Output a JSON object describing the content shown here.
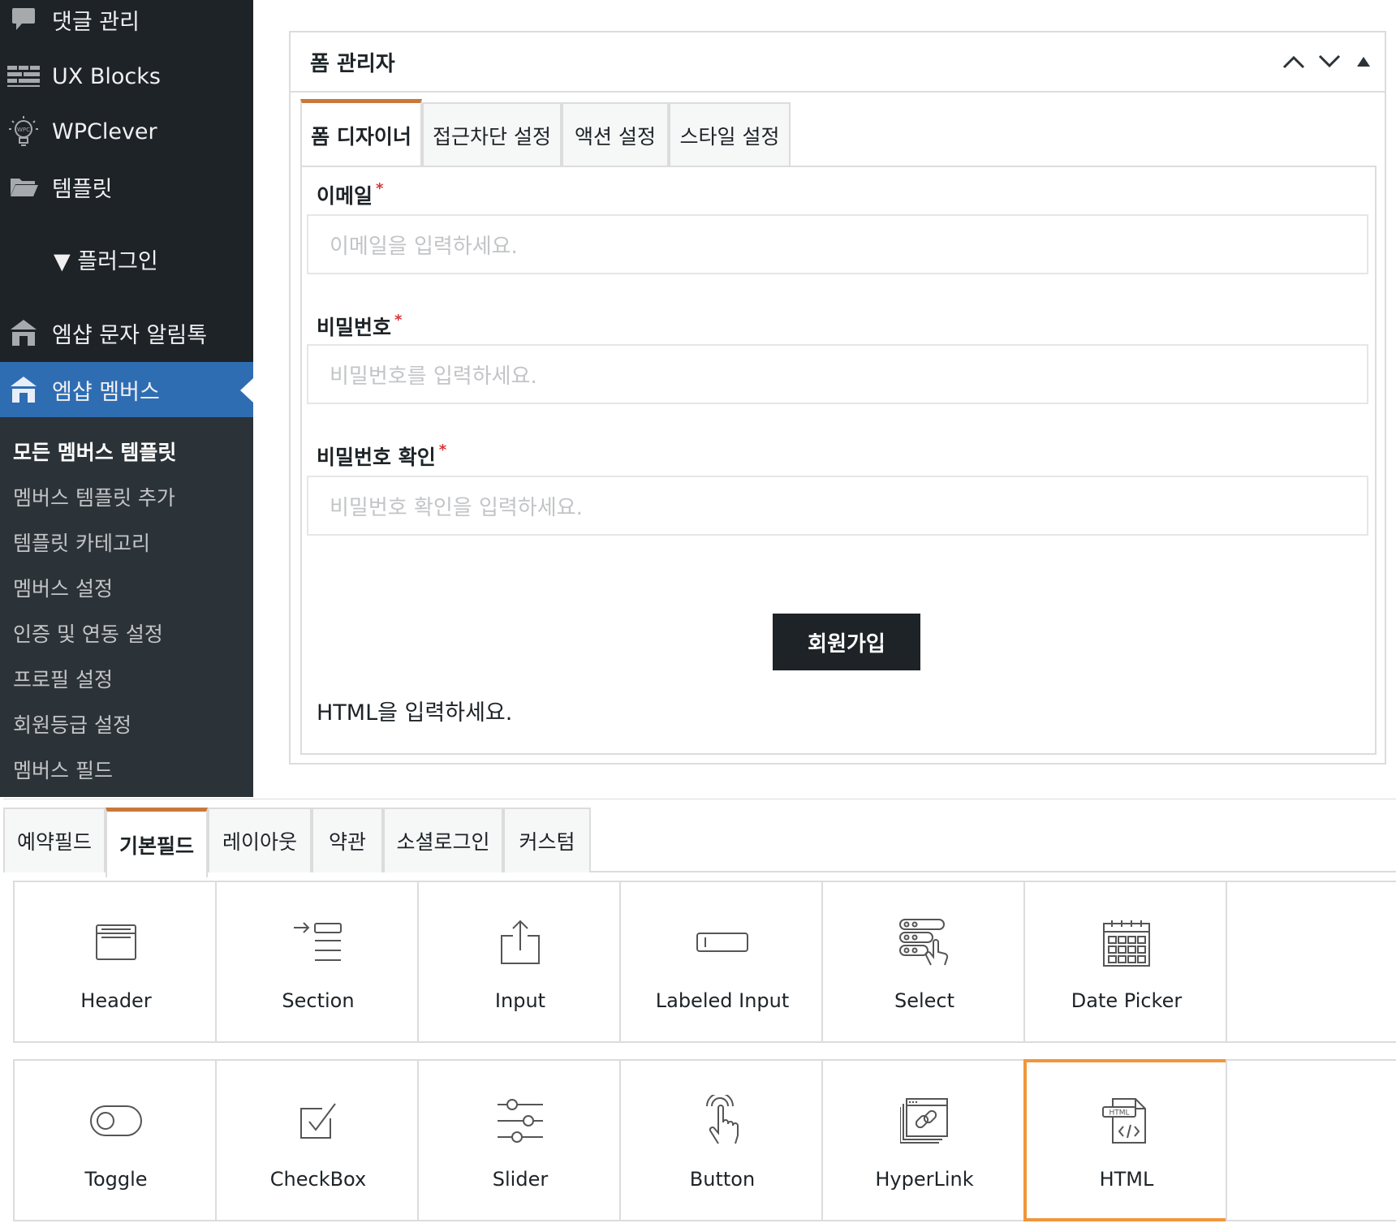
{
  "sidebar": {
    "items": [
      {
        "label": "댓글 관리",
        "icon": "comment-icon"
      },
      {
        "label": "UX Blocks",
        "icon": "blocks-icon"
      },
      {
        "label": "WPClever",
        "icon": "wpclever-icon"
      },
      {
        "label": "템플릿",
        "icon": "folder-icon"
      }
    ],
    "plugins_label": "▼ 플러그인",
    "sms_item": {
      "label": "엠샵 문자 알림톡",
      "icon": "shop-icon"
    },
    "members_item": {
      "label": "엠샵 멤버스",
      "icon": "shop-icon"
    },
    "submenu": [
      "모든 멤버스 템플릿",
      "멤버스 템플릿 추가",
      "템플릿 카테고리",
      "멤버스 설정",
      "인증 및 연동 설정",
      "프로필 설정",
      "회원등급 설정",
      "멤버스 필드"
    ]
  },
  "panel": {
    "title": "폼 관리자",
    "tabs": [
      "폼 디자이너",
      "접근차단 설정",
      "액션 설정",
      "스타일 설정"
    ],
    "active_tab": "폼 디자이너",
    "fields": [
      {
        "label": "이메일",
        "required_mark": "*",
        "placeholder": "이메일을 입력하세요."
      },
      {
        "label": "비밀번호",
        "required_mark": "*",
        "placeholder": "비밀번호를 입력하세요."
      },
      {
        "label": "비밀번호 확인",
        "required_mark": "*",
        "placeholder": "비밀번호 확인을 입력하세요."
      }
    ],
    "submit_label": "회원가입",
    "html_text": "HTML을 입력하세요."
  },
  "palette": {
    "tabs": [
      "예약필드",
      "기본필드",
      "레이아웃",
      "약관",
      "소셜로그인",
      "커스텀"
    ],
    "active_tab": "기본필드",
    "tiles": [
      {
        "label": "Header",
        "icon": "header-icon"
      },
      {
        "label": "Section",
        "icon": "section-icon"
      },
      {
        "label": "Input",
        "icon": "input-icon"
      },
      {
        "label": "Labeled Input",
        "icon": "labeled-input-icon"
      },
      {
        "label": "Select",
        "icon": "select-icon"
      },
      {
        "label": "Date Picker",
        "icon": "calendar-icon"
      },
      {
        "label": "Toggle",
        "icon": "toggle-icon"
      },
      {
        "label": "CheckBox",
        "icon": "checkbox-icon"
      },
      {
        "label": "Slider",
        "icon": "slider-icon"
      },
      {
        "label": "Button",
        "icon": "tap-icon"
      },
      {
        "label": "HyperLink",
        "icon": "link-icon"
      },
      {
        "label": "HTML",
        "icon": "html-icon"
      }
    ],
    "selected_tile": "HTML"
  },
  "colors": {
    "sidebar_bg": "#1d2327",
    "submenu_bg": "#2c3338",
    "active_menu": "#2f6db3",
    "tab_accent": "#c9783a",
    "selected_tile_border": "#f0963a",
    "required_mark": "#d63638"
  }
}
